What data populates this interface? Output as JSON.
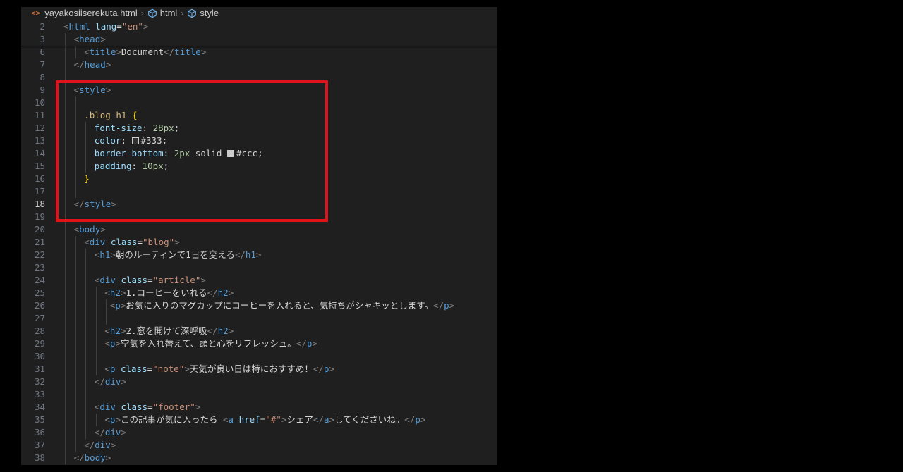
{
  "breadcrumb": {
    "file_icon": "<>",
    "file": "yayakosiiserekuta.html",
    "items": [
      "html",
      "style"
    ]
  },
  "colors": {
    "highlight": "#e0131d",
    "swatch_333": "#333333",
    "swatch_ccc": "#cccccc"
  },
  "lines": [
    {
      "n": "2",
      "indent": 0,
      "tokens": [
        [
          "brk",
          "<"
        ],
        [
          "tag",
          "html"
        ],
        [
          "text",
          " "
        ],
        [
          "attr",
          "lang"
        ],
        [
          "text",
          "="
        ],
        [
          "str",
          "\"en\""
        ],
        [
          "brk",
          ">"
        ]
      ]
    },
    {
      "n": "3",
      "indent": 1,
      "tokens": [
        [
          "brk",
          "<"
        ],
        [
          "tag",
          "head"
        ],
        [
          "brk",
          ">"
        ]
      ]
    },
    {
      "n": "6",
      "indent": 2,
      "tokens": [
        [
          "brk",
          "<"
        ],
        [
          "tag",
          "title"
        ],
        [
          "brk",
          ">"
        ],
        [
          "text",
          "Document"
        ],
        [
          "brk",
          "</"
        ],
        [
          "tag",
          "title"
        ],
        [
          "brk",
          ">"
        ]
      ]
    },
    {
      "n": "7",
      "indent": 1,
      "tokens": [
        [
          "brk",
          "</"
        ],
        [
          "tag",
          "head"
        ],
        [
          "brk",
          ">"
        ]
      ]
    },
    {
      "n": "8",
      "indent": 0,
      "tokens": []
    },
    {
      "n": "9",
      "indent": 1,
      "tokens": [
        [
          "brk",
          "<"
        ],
        [
          "tag",
          "style"
        ],
        [
          "brk",
          ">"
        ]
      ]
    },
    {
      "n": "10",
      "indent": 0,
      "tokens": []
    },
    {
      "n": "11",
      "indent": 2,
      "tokens": [
        [
          "sel",
          ".blog h1"
        ],
        [
          "text",
          " "
        ],
        [
          "brace",
          "{"
        ]
      ]
    },
    {
      "n": "12",
      "indent": 3,
      "tokens": [
        [
          "prop",
          "font-size"
        ],
        [
          "text",
          ": "
        ],
        [
          "num",
          "28px"
        ],
        [
          "text",
          ";"
        ]
      ]
    },
    {
      "n": "13",
      "indent": 3,
      "tokens": [
        [
          "prop",
          "color"
        ],
        [
          "text",
          ": "
        ],
        [
          "swatch",
          "#333333"
        ],
        [
          "text",
          "#333;"
        ]
      ]
    },
    {
      "n": "14",
      "indent": 3,
      "tokens": [
        [
          "prop",
          "border-bottom"
        ],
        [
          "text",
          ": "
        ],
        [
          "num",
          "2px"
        ],
        [
          "text",
          " solid "
        ],
        [
          "swatch",
          "#cccccc"
        ],
        [
          "text",
          "#ccc;"
        ]
      ]
    },
    {
      "n": "15",
      "indent": 3,
      "tokens": [
        [
          "prop",
          "padding"
        ],
        [
          "text",
          ": "
        ],
        [
          "num",
          "10px"
        ],
        [
          "text",
          ";"
        ]
      ]
    },
    {
      "n": "16",
      "indent": 2,
      "tokens": [
        [
          "brace",
          "}"
        ]
      ]
    },
    {
      "n": "17",
      "indent": 0,
      "tokens": []
    },
    {
      "n": "18",
      "indent": 1,
      "tokens": [
        [
          "brk",
          "</"
        ],
        [
          "tag",
          "style"
        ],
        [
          "brk",
          ">"
        ]
      ]
    },
    {
      "n": "19",
      "indent": 0,
      "tokens": []
    },
    {
      "n": "20",
      "indent": 1,
      "tokens": [
        [
          "brk",
          "<"
        ],
        [
          "tag",
          "body"
        ],
        [
          "brk",
          ">"
        ]
      ]
    },
    {
      "n": "21",
      "indent": 2,
      "tokens": [
        [
          "brk",
          "<"
        ],
        [
          "tag",
          "div"
        ],
        [
          "text",
          " "
        ],
        [
          "attr",
          "class"
        ],
        [
          "text",
          "="
        ],
        [
          "str",
          "\"blog\""
        ],
        [
          "brk",
          ">"
        ]
      ]
    },
    {
      "n": "22",
      "indent": 3,
      "tokens": [
        [
          "brk",
          "<"
        ],
        [
          "tag",
          "h1"
        ],
        [
          "brk",
          ">"
        ],
        [
          "text",
          "朝のルーティンで1日を変える"
        ],
        [
          "brk",
          "</"
        ],
        [
          "tag",
          "h1"
        ],
        [
          "brk",
          ">"
        ]
      ]
    },
    {
      "n": "23",
      "indent": 0,
      "tokens": []
    },
    {
      "n": "24",
      "indent": 3,
      "tokens": [
        [
          "brk",
          "<"
        ],
        [
          "tag",
          "div"
        ],
        [
          "text",
          " "
        ],
        [
          "attr",
          "class"
        ],
        [
          "text",
          "="
        ],
        [
          "str",
          "\"article\""
        ],
        [
          "brk",
          ">"
        ]
      ]
    },
    {
      "n": "25",
      "indent": 4,
      "tokens": [
        [
          "brk",
          "<"
        ],
        [
          "tag",
          "h2"
        ],
        [
          "brk",
          ">"
        ],
        [
          "text",
          "1.コーヒーをいれる"
        ],
        [
          "brk",
          "</"
        ],
        [
          "tag",
          "h2"
        ],
        [
          "brk",
          ">"
        ]
      ]
    },
    {
      "n": "26",
      "indent": 4.5,
      "tokens": [
        [
          "brk",
          "<"
        ],
        [
          "tag",
          "p"
        ],
        [
          "brk",
          ">"
        ],
        [
          "text",
          "お気に入りのマグカップにコーヒーを入れると、気持ちがシャキッとします。"
        ],
        [
          "brk",
          "</"
        ],
        [
          "tag",
          "p"
        ],
        [
          "brk",
          ">"
        ]
      ]
    },
    {
      "n": "27",
      "indent": 0,
      "tokens": []
    },
    {
      "n": "28",
      "indent": 4,
      "tokens": [
        [
          "brk",
          "<"
        ],
        [
          "tag",
          "h2"
        ],
        [
          "brk",
          ">"
        ],
        [
          "text",
          "2.窓を開けて深呼吸"
        ],
        [
          "brk",
          "</"
        ],
        [
          "tag",
          "h2"
        ],
        [
          "brk",
          ">"
        ]
      ]
    },
    {
      "n": "29",
      "indent": 4,
      "tokens": [
        [
          "brk",
          "<"
        ],
        [
          "tag",
          "p"
        ],
        [
          "brk",
          ">"
        ],
        [
          "text",
          "空気を入れ替えて、頭と心をリフレッシュ。"
        ],
        [
          "brk",
          "</"
        ],
        [
          "tag",
          "p"
        ],
        [
          "brk",
          ">"
        ]
      ]
    },
    {
      "n": "30",
      "indent": 0,
      "tokens": []
    },
    {
      "n": "31",
      "indent": 4,
      "tokens": [
        [
          "brk",
          "<"
        ],
        [
          "tag",
          "p"
        ],
        [
          "text",
          " "
        ],
        [
          "attr",
          "class"
        ],
        [
          "text",
          "="
        ],
        [
          "str",
          "\"note\""
        ],
        [
          "brk",
          ">"
        ],
        [
          "text",
          "天気が良い日は特におすすめ！"
        ],
        [
          "brk",
          "</"
        ],
        [
          "tag",
          "p"
        ],
        [
          "brk",
          ">"
        ]
      ]
    },
    {
      "n": "32",
      "indent": 3,
      "tokens": [
        [
          "brk",
          "</"
        ],
        [
          "tag",
          "div"
        ],
        [
          "brk",
          ">"
        ]
      ]
    },
    {
      "n": "33",
      "indent": 0,
      "tokens": []
    },
    {
      "n": "34",
      "indent": 3,
      "tokens": [
        [
          "brk",
          "<"
        ],
        [
          "tag",
          "div"
        ],
        [
          "text",
          " "
        ],
        [
          "attr",
          "class"
        ],
        [
          "text",
          "="
        ],
        [
          "str",
          "\"footer\""
        ],
        [
          "brk",
          ">"
        ]
      ]
    },
    {
      "n": "35",
      "indent": 4,
      "tokens": [
        [
          "brk",
          "<"
        ],
        [
          "tag",
          "p"
        ],
        [
          "brk",
          ">"
        ],
        [
          "text",
          "この記事が気に入ったら "
        ],
        [
          "brk",
          "<"
        ],
        [
          "tag",
          "a"
        ],
        [
          "text",
          " "
        ],
        [
          "attr",
          "href"
        ],
        [
          "text",
          "="
        ],
        [
          "str",
          "\"#\""
        ],
        [
          "brk",
          ">"
        ],
        [
          "text",
          "シェア"
        ],
        [
          "brk",
          "</"
        ],
        [
          "tag",
          "a"
        ],
        [
          "brk",
          ">"
        ],
        [
          "text",
          "してくださいね。"
        ],
        [
          "brk",
          "</"
        ],
        [
          "tag",
          "p"
        ],
        [
          "brk",
          ">"
        ]
      ]
    },
    {
      "n": "36",
      "indent": 3,
      "tokens": [
        [
          "brk",
          "</"
        ],
        [
          "tag",
          "div"
        ],
        [
          "brk",
          ">"
        ]
      ]
    },
    {
      "n": "37",
      "indent": 2,
      "tokens": [
        [
          "brk",
          "</"
        ],
        [
          "tag",
          "div"
        ],
        [
          "brk",
          ">"
        ]
      ]
    },
    {
      "n": "38",
      "indent": 1,
      "tokens": [
        [
          "brk",
          "</"
        ],
        [
          "tag",
          "body"
        ],
        [
          "brk",
          ">"
        ]
      ]
    }
  ],
  "active_line": "18"
}
